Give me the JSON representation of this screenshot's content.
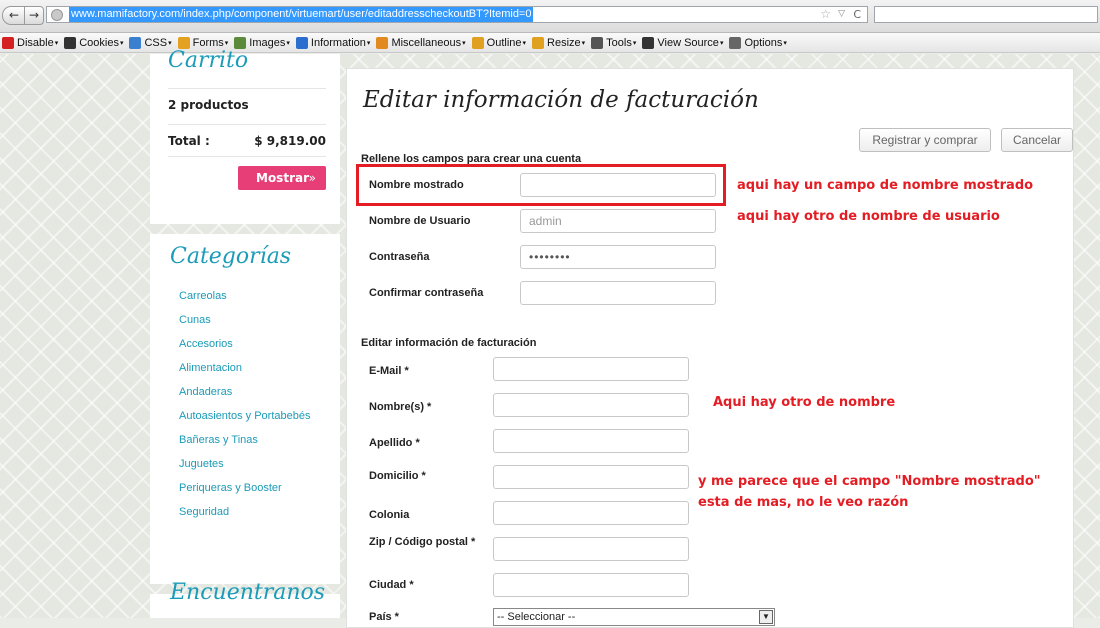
{
  "browser": {
    "url": "www.mamifactory.com/index.php/component/virtuemart/user/editaddresscheckoutBT?Itemid=0",
    "toolbar": [
      {
        "label": "Disable",
        "icon": "disable-icon",
        "color": "#d42020"
      },
      {
        "label": "Cookies",
        "icon": "cookie-person-icon",
        "color": "#333333"
      },
      {
        "label": "CSS",
        "icon": "css-pencil-icon",
        "color": "#3a7fd0"
      },
      {
        "label": "Forms",
        "icon": "forms-icon",
        "color": "#e4a020"
      },
      {
        "label": "Images",
        "icon": "images-icon",
        "color": "#5a8a3a"
      },
      {
        "label": "Information",
        "icon": "information-icon",
        "color": "#2a6fd0"
      },
      {
        "label": "Miscellaneous",
        "icon": "miscellaneous-icon",
        "color": "#e08a20"
      },
      {
        "label": "Outline",
        "icon": "outline-pencil-icon",
        "color": "#e0a020"
      },
      {
        "label": "Resize",
        "icon": "resize-pencil-icon",
        "color": "#e0a020"
      },
      {
        "label": "Tools",
        "icon": "tools-icon",
        "color": "#555555"
      },
      {
        "label": "View Source",
        "icon": "view-source-icon",
        "color": "#333333"
      },
      {
        "label": "Options",
        "icon": "options-icon",
        "color": "#666666"
      }
    ]
  },
  "sidebar": {
    "cart": {
      "title": "Carrito",
      "products": "2 productos",
      "total_label": "Total :",
      "total_value": "$ 9,819.00",
      "show_label": "Mostrar",
      "chevron": "»"
    },
    "categories": {
      "title": "Categorías",
      "items": [
        "Carreolas",
        "Cunas",
        "Accesorios",
        "Alimentacion",
        "Andaderas",
        "Autoasientos y Portabebés",
        "Bañeras y Tinas",
        "Juguetes",
        "Periqueras y Booster",
        "Seguridad"
      ]
    },
    "find": {
      "title": "Encuentranos"
    }
  },
  "main": {
    "title": "Editar información de facturación",
    "register_label": "Registrar y comprar",
    "cancel_label": "Cancelar",
    "instructions": "Rellene los campos para crear una cuenta",
    "account_fields": [
      {
        "label": "Nombre mostrado",
        "value": ""
      },
      {
        "label": "Nombre de Usuario",
        "value": "admin"
      },
      {
        "label": "Contraseña",
        "value": "••••••••"
      },
      {
        "label": "Confirmar contraseña",
        "value": ""
      }
    ],
    "billing_title": "Editar información de facturación",
    "billing_fields": [
      {
        "label": "E-Mail *"
      },
      {
        "label": "Nombre(s) *"
      },
      {
        "label": "Apellido *"
      },
      {
        "label": "Domicilio *"
      },
      {
        "label": "Colonia"
      },
      {
        "label": "Zip / Código postal *"
      },
      {
        "label": "Ciudad *"
      },
      {
        "label": "País *"
      }
    ],
    "country_select": "-- Seleccionar --"
  },
  "annotations": {
    "note1": "aqui hay un campo de nombre mostrado",
    "note2": "aqui hay otro de nombre de usuario",
    "note3": "Aqui hay otro de nombre",
    "note4_line1": "y me parece que el campo \"Nombre mostrado\"",
    "note4_line2": "esta de mas, no le veo razón",
    "color": "#e31d23"
  }
}
